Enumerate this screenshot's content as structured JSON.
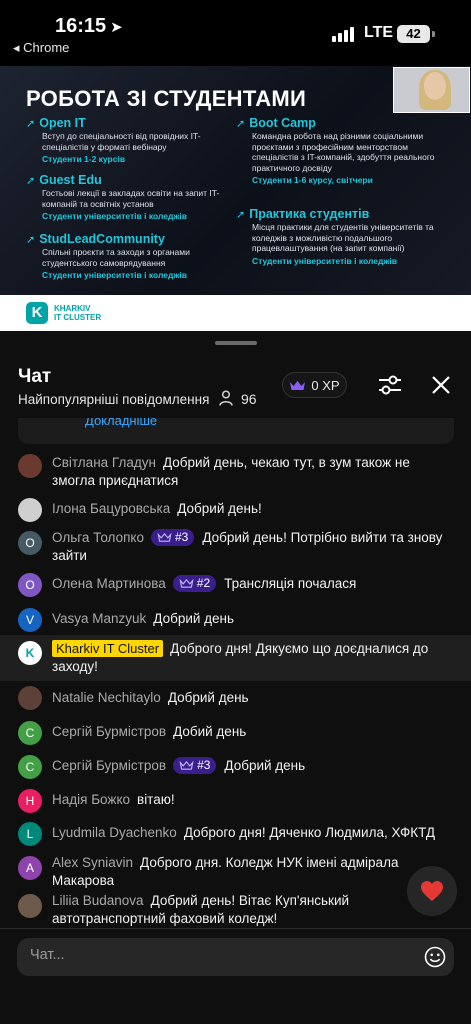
{
  "status_bar": {
    "time": "16:15",
    "back_app": "◂ Chrome",
    "network": "LTE",
    "battery": "42"
  },
  "video": {
    "slide_title": "РОБОТА ЗІ СТУДЕНТАМИ",
    "blocks": [
      {
        "title": "Open IT",
        "desc": "Вступ до спеціальності від провідних IT-спеціалістів у форматі вебінару",
        "sub": "Студенти 1-2 курсів"
      },
      {
        "title": "Guest Edu",
        "desc": "Гостьові лекції в закладах освіти на запит IT-компаній та освітніх установ",
        "sub": "Студенти університетів і коледжів"
      },
      {
        "title": "StudLeadCommunity",
        "desc": "Спільні проєкти та заходи з органами студентського самоврядування",
        "sub": "Студенти університетів і коледжів"
      },
      {
        "title": "Boot Camp",
        "desc": "Командна робота над різними соціальними проєктами з професійним менторством спеціалістів з IT-компаній, здобуття реального практичного досвіду",
        "sub": "Студенти 1-6 курсу, світчери"
      },
      {
        "title": "Практика студентів",
        "desc": "Місця практики для студентів університетів та коледжів з можливістю подальшого працевлаштування (на запит компанії)",
        "sub": "Студенти університетів і коледжів"
      }
    ],
    "logo_line1": "KHARKIV",
    "logo_line2": "IT CLUSTER",
    "logo_letter": "K"
  },
  "chat": {
    "title": "Чат",
    "filter": "Найпопулярніші повідомлення",
    "viewers": "96",
    "xp": "0 XP",
    "pinned_more": "Докладніше",
    "input_placeholder": "Чат...",
    "messages": [
      {
        "author": "Світлана Гладун",
        "text": "Добрий день, чекаю тут, в зум також не змогла приєднатися",
        "avatar": "",
        "avatar_color": "#6b3a2e"
      },
      {
        "author": "Ілона Бацуровська",
        "text": "Добрий день!",
        "avatar": "",
        "avatar_color": "#cfcfcf"
      },
      {
        "author": "Ольга Толопко",
        "badge": "#3",
        "text": "Добрий день! Потрібно вийти та знову зайти",
        "avatar": "О",
        "avatar_color": "#455a64"
      },
      {
        "author": "Олена Мартинова",
        "badge": "#2",
        "text": "Трансляція почалася",
        "avatar": "О",
        "avatar_color": "#7e57c2"
      },
      {
        "author": "Vasya Manzyuk",
        "text": "Добрий день",
        "avatar": "V",
        "avatar_color": "#1565c0"
      },
      {
        "author": "Kharkiv IT Cluster",
        "owner": true,
        "text": "Доброго дня! Дякуємо що доєдналися до заходу!",
        "avatar": "K",
        "avatar_color": "#ffffff"
      },
      {
        "author": "Natalie Nechitaylo",
        "text": "Добрий день",
        "avatar": "",
        "avatar_color": "#5d4037"
      },
      {
        "author": "Сергій Бурмістров",
        "text": "Добий день",
        "avatar": "С",
        "avatar_color": "#43a047"
      },
      {
        "author": "Сергій Бурмістров",
        "badge": "#3",
        "text": "Добрий день",
        "avatar": "С",
        "avatar_color": "#43a047"
      },
      {
        "author": "Надія Божко",
        "text": "вітаю!",
        "avatar": "Н",
        "avatar_color": "#e91e63"
      },
      {
        "author": "Lyudmila Dyachenko",
        "text": "Доброго дня! Дяченко Людмила, ХФКТД",
        "avatar": "L",
        "avatar_color": "#00897b"
      },
      {
        "author": "Alex Syniavin",
        "text": "Доброго дня. Коледж НУК імені адмірала Макарова",
        "avatar": "A",
        "avatar_color": "#8e44ad"
      },
      {
        "author": "Liliia Budanova",
        "text": "Добрий день! Вітає Куп'янський автотранспортний фаховий коледж!",
        "avatar": "",
        "avatar_color": "#6d5a4a"
      }
    ]
  }
}
